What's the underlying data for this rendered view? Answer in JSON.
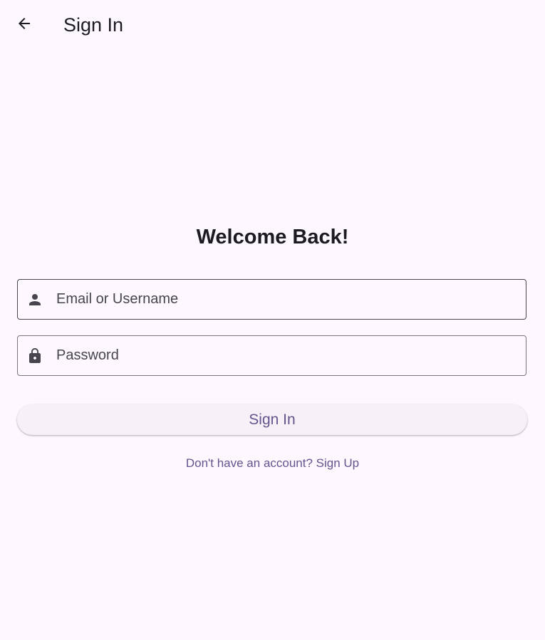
{
  "app_bar": {
    "back_icon": "arrow-back-icon",
    "title": "Sign In"
  },
  "main": {
    "heading": "Welcome Back!",
    "email_field": {
      "icon": "person-icon",
      "placeholder": "Email or Username",
      "value": ""
    },
    "password_field": {
      "icon": "lock-icon",
      "placeholder": "Password",
      "value": ""
    },
    "signin_button_label": "Sign In",
    "signup_link_text": "Don't have an account? Sign Up"
  },
  "colors": {
    "background": "#fdf7fe",
    "accent": "#65558f",
    "outline": "#79747e",
    "text": "#1d1b20"
  }
}
